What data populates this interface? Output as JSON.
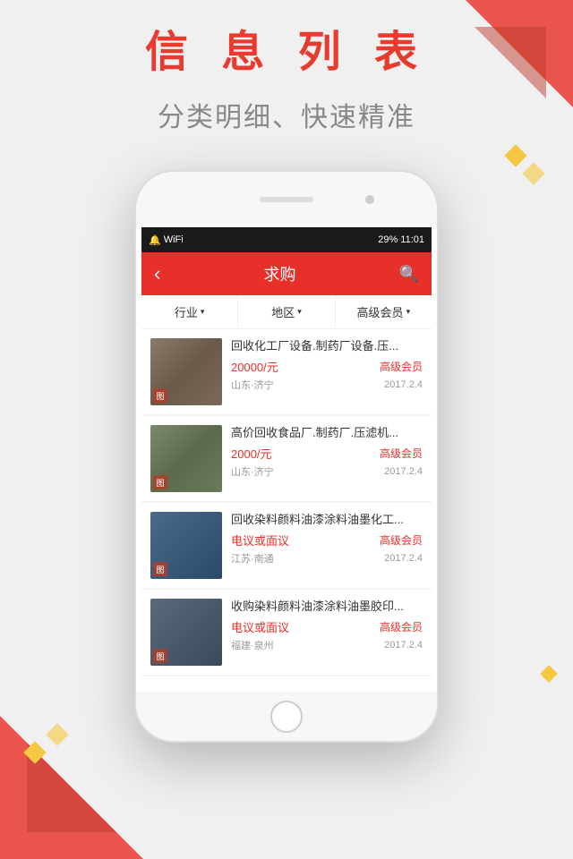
{
  "page": {
    "background_color": "#f0f0f0",
    "main_title": "信 息 列 表",
    "sub_title": "分类明细、快速精准"
  },
  "status_bar": {
    "left_icons": "◂ ▪",
    "signal": "29%",
    "time": "11:01"
  },
  "nav_bar": {
    "back_icon": "‹",
    "title": "求购",
    "search_icon": "⌕"
  },
  "filter_bar": {
    "items": [
      {
        "label": "行业",
        "arrow": "▾"
      },
      {
        "label": "地区",
        "arrow": "▾"
      },
      {
        "label": "高级会员",
        "arrow": "▾"
      }
    ]
  },
  "list_items": [
    {
      "title": "回收化工厂设备.制药厂设备.压...",
      "price": "20000/元",
      "badge": "高级会员",
      "location": "山东·济宁",
      "date": "2017.2.4",
      "img_type": "1"
    },
    {
      "title": "高价回收食品厂.制药厂.压滤机...",
      "price": "2000/元",
      "badge": "高级会员",
      "location": "山东·济宁",
      "date": "2017.2.4",
      "img_type": "2"
    },
    {
      "title": "回收染料颜料油漆涂料油墨化工...",
      "price": "电议或面议",
      "badge": "高级会员",
      "location": "江苏·南通",
      "date": "2017.2.4",
      "img_type": "3"
    },
    {
      "title": "收购染料颜料油漆涂料油墨胶印...",
      "price": "电议或面议",
      "badge": "高级会员",
      "location": "福建·泉州",
      "date": "2017.2.4",
      "img_type": "4"
    }
  ]
}
